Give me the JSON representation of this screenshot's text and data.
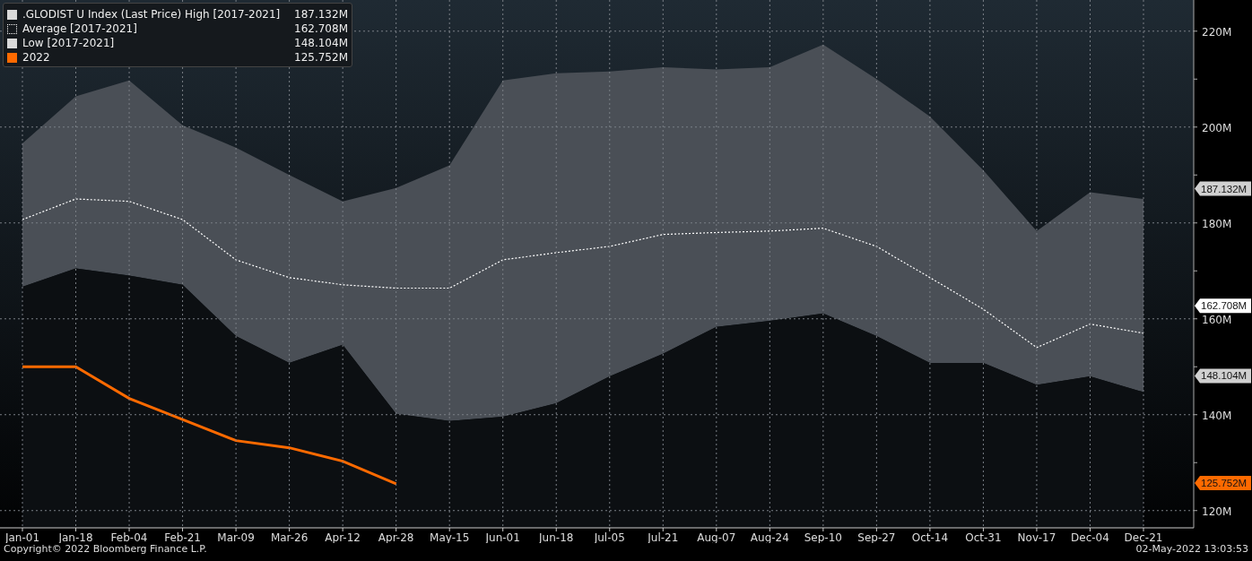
{
  "chart": {
    "chart_data": {
      "type": "area",
      "categories": [
        "Jan-01",
        "Jan-18",
        "Feb-04",
        "Feb-21",
        "Mar-09",
        "Mar-26",
        "Apr-12",
        "Apr-28",
        "May-15",
        "Jun-01",
        "Jun-18",
        "Jul-05",
        "Jul-21",
        "Aug-07",
        "Aug-24",
        "Sep-10",
        "Sep-27",
        "Oct-14",
        "Oct-31",
        "Nov-17",
        "Dec-04",
        "Dec-21"
      ],
      "series": [
        {
          "name": ".GLODIST U Index (Last Price) High [2017-2021]",
          "type": "area",
          "color": "#4a4f56",
          "values": [
            196.6,
            206.4,
            209.7,
            200.4,
            195.7,
            190,
            184.5,
            187.3,
            192,
            209.7,
            211.2,
            211.6,
            212.5,
            212,
            212.5,
            217.2,
            210,
            202.2,
            191,
            178.3,
            186.4,
            185
          ]
        },
        {
          "name": "Average  [2017-2021]",
          "type": "line",
          "line_style": "dotted",
          "color": "#ffffff",
          "values": [
            180.7,
            185,
            184.5,
            180.7,
            172.3,
            168.6,
            167.1,
            166.4,
            166.4,
            172.3,
            173.8,
            175.1,
            177.6,
            178,
            178.3,
            178.9,
            175.1,
            168.6,
            162,
            154,
            158.9,
            157
          ]
        },
        {
          "name": "Low  [2017-2021]",
          "type": "area",
          "color": "#0c0f12",
          "values": [
            166.7,
            170.5,
            169,
            167.1,
            156.4,
            150.8,
            154.6,
            140.2,
            138.7,
            139.6,
            142.4,
            148,
            152.7,
            158.3,
            159.6,
            161.1,
            156.4,
            150.8,
            150.8,
            146.2,
            148,
            144.7
          ]
        },
        {
          "name": "2022",
          "type": "line",
          "line_style": "solid",
          "color": "#ff6a00",
          "values": [
            150,
            150,
            143.4,
            139,
            134.6,
            133.1,
            130.3,
            125.6,
            null,
            null,
            null,
            null,
            null,
            null,
            null,
            null,
            null,
            null,
            null,
            null,
            null,
            null
          ]
        }
      ],
      "ylim": [
        116.4,
        226.5
      ],
      "grid": true,
      "yticks": [
        {
          "value": 120,
          "label": "120M"
        },
        {
          "value": 140,
          "label": "140M"
        },
        {
          "value": 160,
          "label": "160M"
        },
        {
          "value": 180,
          "label": "180M"
        },
        {
          "value": 200,
          "label": "200M"
        },
        {
          "value": 220,
          "label": "220M"
        }
      ]
    },
    "legend": [
      {
        "kind": "filled",
        "color": "#d9d9d9",
        "value": "187.132M"
      },
      {
        "kind": "dotted",
        "color": "#ffffff",
        "value": "162.708M"
      },
      {
        "kind": "filled",
        "color": "#d9d9d9",
        "value": "148.104M"
      },
      {
        "kind": "filled",
        "color": "#ff6a00",
        "value": "125.752M"
      }
    ],
    "price_tags": [
      {
        "label": "187.132M",
        "color": "#d0d0d0"
      },
      {
        "label": "162.708M",
        "color": "#ffffff"
      },
      {
        "label": "148.104M",
        "color": "#d0d0d0"
      },
      {
        "label": "125.752M",
        "color": "#ff6a00"
      }
    ]
  },
  "footer": {
    "copyright": "Copyright© 2022 Bloomberg Finance L.P.",
    "timestamp": "02-May-2022 13:03:53"
  }
}
